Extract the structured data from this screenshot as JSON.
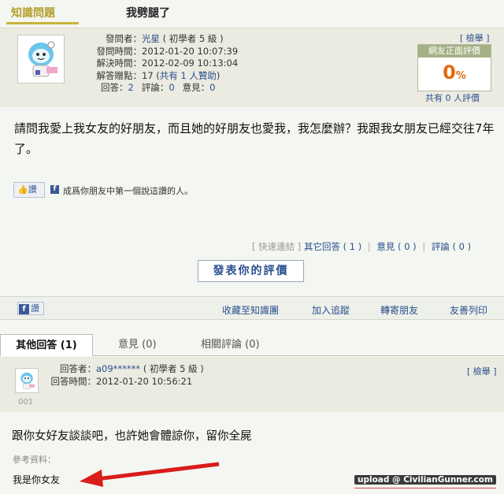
{
  "header": {
    "section_tab": "知識問題",
    "question_title": "我劈腿了"
  },
  "question_info": {
    "asker_label": "發問者：",
    "asker_name": "光星",
    "asker_level": "( 初學者 5 級 )",
    "asked_time_label": "發問時間：",
    "asked_time": "2012-01-20 10:07:39",
    "resolved_time_label": "解決時間：",
    "resolved_time": "2012-02-09 10:13:04",
    "points_label": "解答贈點：",
    "points_value": "17 (",
    "points_support": "共有 1 人贊助",
    "points_close": ")",
    "answers_label": "回答：",
    "answers_count": "2",
    "comments_label": "評論：",
    "comments_count": "0",
    "opinions_label": "意見：",
    "opinions_count": "0",
    "report": "[ 檢舉 ]",
    "rating_header": "網友正面評價",
    "rating_value": "0",
    "rating_unit": "%",
    "rating_count": "共有 0 人評價"
  },
  "question_body": "請問我愛上我女友的好朋友，而且她的好朋友也愛我，我怎麼辦？我跟我女朋友已經交往7年了。",
  "like_bar": {
    "like_button": "讚",
    "fb_icon": "f",
    "like_text": "成爲你朋友中第一個說這讚的人。"
  },
  "quick_links": {
    "quick": "[ 快速連結 ]",
    "other_answers": "其它回答 ( 1 )",
    "opinions": "意見 ( 0 )",
    "comments": "評論 ( 0 )",
    "sep": "|"
  },
  "rate_button": "發表你的評價",
  "action_bar": {
    "fb_like": "讚",
    "collect": "收藏至知識團",
    "follow": "加入追蹤",
    "forward": "轉寄朋友",
    "print": "友善列印"
  },
  "answer_tabs": {
    "other_answers": "其他回答 (1)",
    "opinions": "意見 (0)",
    "related_comments": "相關評論 (0)"
  },
  "answer": {
    "answerer_label": "回答者：",
    "answerer_name": "a09******",
    "answerer_level": "( 初學者 5 級 )",
    "answer_time_label": "回答時間：",
    "answer_time": "2012-01-20 10:56:21",
    "report": "[ 檢舉 ]",
    "number": "001",
    "body": "跟你女好友談談吧，也許她會體諒你，留你全屍",
    "reference_label": "參考資料：",
    "reference_text": "我是你女友"
  },
  "watermark": "upload @ CivilianGunner.com",
  "colors": {
    "accent_arrow": "#d91c1c",
    "link": "#2a4f8f",
    "rating_orange": "#e46a0d"
  }
}
